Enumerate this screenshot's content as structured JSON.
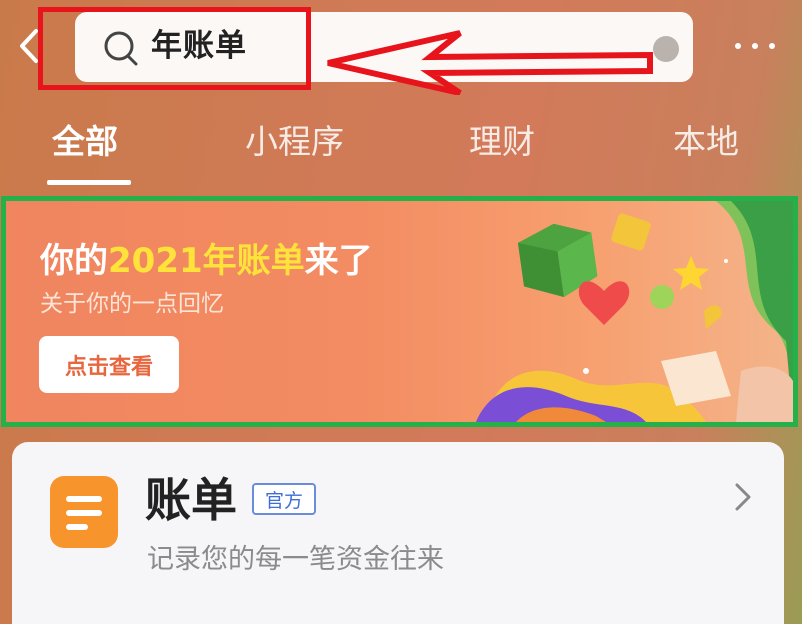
{
  "search": {
    "query": "年账单"
  },
  "tabs": [
    {
      "label": "全部"
    },
    {
      "label": "小程序"
    },
    {
      "label": "理财"
    },
    {
      "label": "本地"
    }
  ],
  "banner": {
    "title_prefix": "你的",
    "title_highlight": "2021年账单",
    "title_suffix": "来了",
    "subtitle": "关于你的一点回忆",
    "button_label": "点击查看"
  },
  "result": {
    "name": "账单",
    "badge": "官方",
    "description": "记录您的每一笔资金往来"
  },
  "colors": {
    "annotation_red": "#e8141c",
    "annotation_green": "#24b14a",
    "highlight_yellow": "#ffe33a",
    "app_icon_orange": "#f7942c",
    "badge_blue": "#3f6ed8"
  }
}
